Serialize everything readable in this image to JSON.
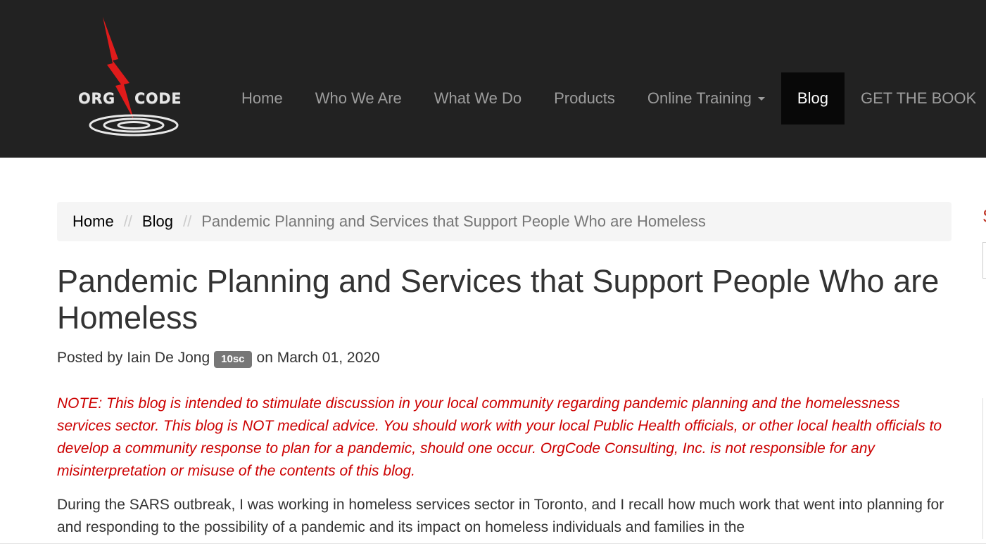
{
  "brand": {
    "logo_left": "ORG",
    "logo_right": "CODE"
  },
  "nav": {
    "items": [
      {
        "label": "Home"
      },
      {
        "label": "Who We Are"
      },
      {
        "label": "What We Do"
      },
      {
        "label": "Products"
      },
      {
        "label": "Online Training"
      },
      {
        "label": "Blog"
      },
      {
        "label": "GET THE BOOK"
      }
    ]
  },
  "breadcrumb": {
    "home": "Home",
    "blog": "Blog",
    "current": "Pandemic Planning and Services that Support People Who are Homeless",
    "separator": "//"
  },
  "post": {
    "title": "Pandemic Planning and Services that Support People Who are Homeless",
    "meta_prefix": "Posted by Iain De Jong",
    "badge": "10sc",
    "meta_suffix": "on March 01, 2020",
    "note": "NOTE: This blog is intended to stimulate discussion in your local community regarding pandemic planning and the homelessness services sector. This blog is NOT medical advice. You should work with your local Public Health officials, or other local health officials to develop a community response to plan for a pandemic, should one occur. OrgCode Consulting, Inc. is not responsible for any misinterpretation or misuse of the contents of this blog.",
    "body": "During the SARS outbreak, I was working in homeless services sector in Toronto, and I recall how much work that went into planning for and responding to the possibility of a pandemic and its impact on homeless individuals and families in the"
  },
  "colors": {
    "navbar_bg": "#222222",
    "nav_active_bg": "#080808",
    "nav_text": "#9d9d9d",
    "note_red": "#cc0000",
    "logo_bolt": "#e01b1b"
  },
  "icons": {
    "logo": "orgcode-lightning-logo",
    "dropdown": "caret-down-icon"
  }
}
